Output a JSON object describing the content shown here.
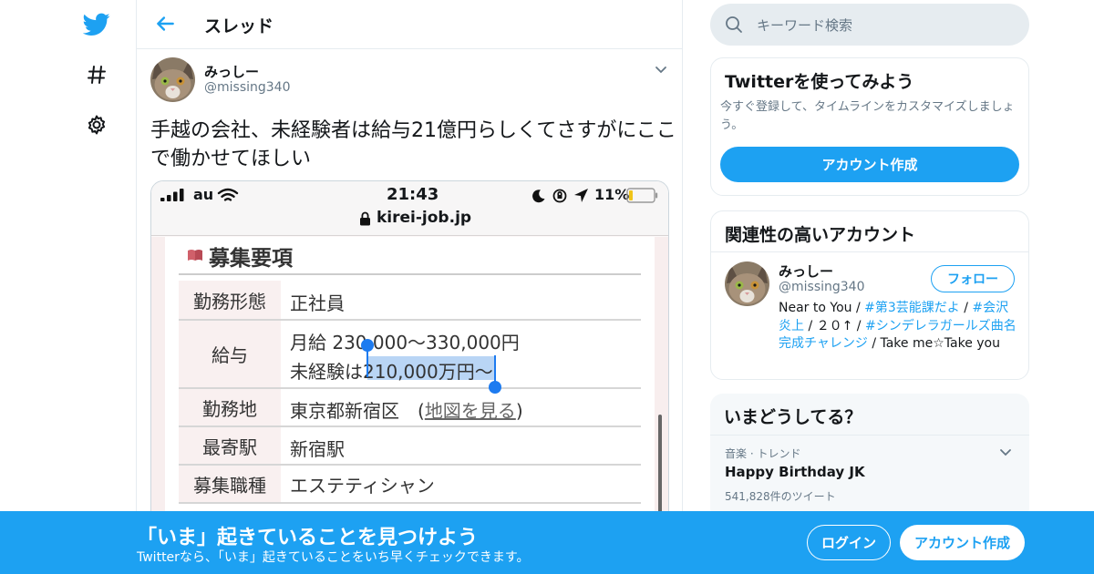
{
  "colors": {
    "accent": "#1da1f2",
    "text": "#14171a",
    "muted": "#657786",
    "border": "#e6ecf0",
    "selection": "#b9d5f5"
  },
  "nav": {
    "icons": [
      "twitter-bird-icon",
      "hashtag-icon",
      "gear-icon"
    ]
  },
  "thread": {
    "title": "スレッド",
    "author": {
      "name": "みっしー",
      "handle": "@missing340"
    },
    "text": "手越の会社、未経験者は給与21億円らしくてさすがにここで働かせてほしい",
    "media": {
      "status_bar": {
        "carrier": "au",
        "time": "21:43",
        "battery": "11%",
        "url": "kirei-job.jp"
      },
      "section_title": "募集要項",
      "rows": [
        {
          "label": "勤務形態",
          "value": "正社員"
        },
        {
          "label": "給与",
          "line1": "月給 230,000〜330,000円",
          "line2_prefix": "未経験は",
          "line2_selected": "210,000万円〜"
        },
        {
          "label": "勤務地",
          "value_prefix": "東京都新宿区　(",
          "link": "地図を見る",
          "value_suffix": ")"
        },
        {
          "label": "最寄駅",
          "value": "新宿駅"
        },
        {
          "label": "募集職種",
          "value": "エステティシャン"
        }
      ]
    }
  },
  "search": {
    "placeholder": "キーワード検索"
  },
  "signup_card": {
    "title": "Twitterを使ってみよう",
    "desc": "今すぐ登録して、タイムラインをカスタマイズしましょう。",
    "button": "アカウント作成"
  },
  "related": {
    "title": "関連性の高いアカウント",
    "name": "みっしー",
    "handle": "@missing340",
    "follow_label": "フォロー",
    "bio": {
      "t1": "Near to You / ",
      "tag1": "#第3芸能課だよ",
      "t2": " / ",
      "tag2": "#会沢炎上",
      "t3": " / ２０↑ / ",
      "tag3": "#シンデレラガールズ曲名完成チャレンジ",
      "t4": " / Take me☆Take you"
    }
  },
  "trends": {
    "title": "いまどうしてる？",
    "item": {
      "context": "音楽 · トレンド",
      "name": "Happy Birthday JK",
      "count": "541,828件のツイート"
    }
  },
  "banner": {
    "title": "「いま」起きていることを見つけよう",
    "subtitle": "Twitterなら、「いま」起きていることをいち早くチェックできます。",
    "login": "ログイン",
    "signup": "アカウント作成"
  }
}
